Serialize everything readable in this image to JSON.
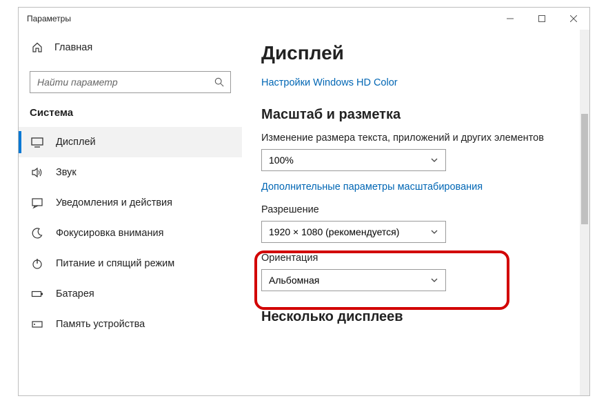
{
  "window": {
    "title": "Параметры"
  },
  "sidebar": {
    "home_label": "Главная",
    "search_placeholder": "Найти параметр",
    "section_label": "Система",
    "items": [
      {
        "label": "Дисплей"
      },
      {
        "label": "Звук"
      },
      {
        "label": "Уведомления и действия"
      },
      {
        "label": "Фокусировка внимания"
      },
      {
        "label": "Питание и спящий режим"
      },
      {
        "label": "Батарея"
      },
      {
        "label": "Память устройства"
      }
    ]
  },
  "main": {
    "page_title": "Дисплей",
    "hd_color_link": "Настройки Windows HD Color",
    "scale_heading": "Масштаб и разметка",
    "scale_label": "Изменение размера текста, приложений и других элементов",
    "scale_value": "100%",
    "advanced_scale_link": "Дополнительные параметры масштабирования",
    "resolution_label": "Разрешение",
    "resolution_value": "1920 × 1080 (рекомендуется)",
    "orientation_label": "Ориентация",
    "orientation_value": "Альбомная",
    "multi_heading": "Несколько дисплеев"
  }
}
